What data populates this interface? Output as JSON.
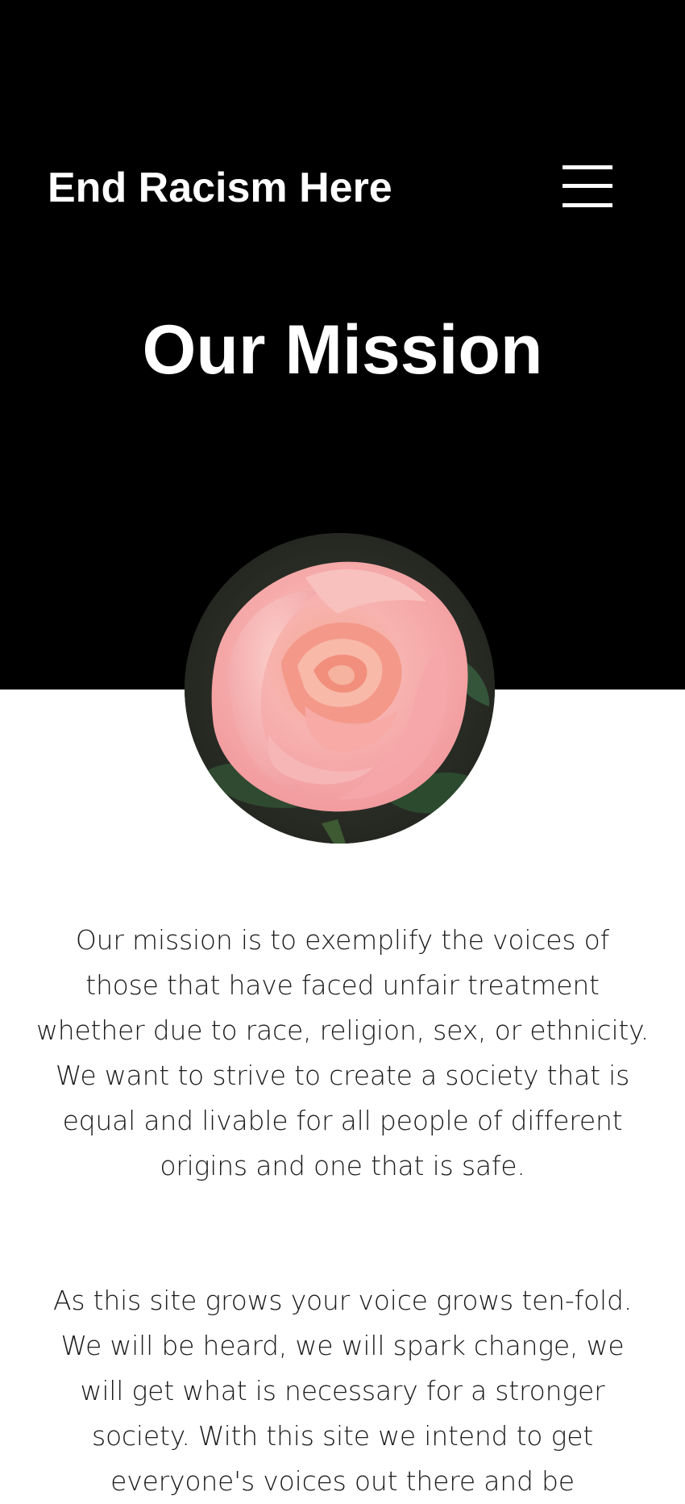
{
  "header": {
    "site_title": "End Racism Here",
    "menu_icon": "hamburger-menu-icon"
  },
  "hero": {
    "page_title": "Our Mission",
    "background_color": "#000000",
    "image": {
      "subject": "pink-rose-photo"
    }
  },
  "content": {
    "paragraphs": [
      "Our mission is to exemplify the voices of those that have faced unfair treatment whether due to race, religion, sex, or ethnicity. We want to strive to create a society that is equal and livable for all people of different origins and one that is safe.",
      "As this site grows your voice grows ten-fold. We will be heard, we will spark change, we will get what is necessary for a stronger society. With this site we intend to get everyone's voices out there and be"
    ]
  },
  "colors": {
    "hero_background": "#000000",
    "page_background": "#ffffff",
    "heading_text": "#ffffff",
    "body_text": "#1b1b1b",
    "rose": "#f4a6a0"
  }
}
